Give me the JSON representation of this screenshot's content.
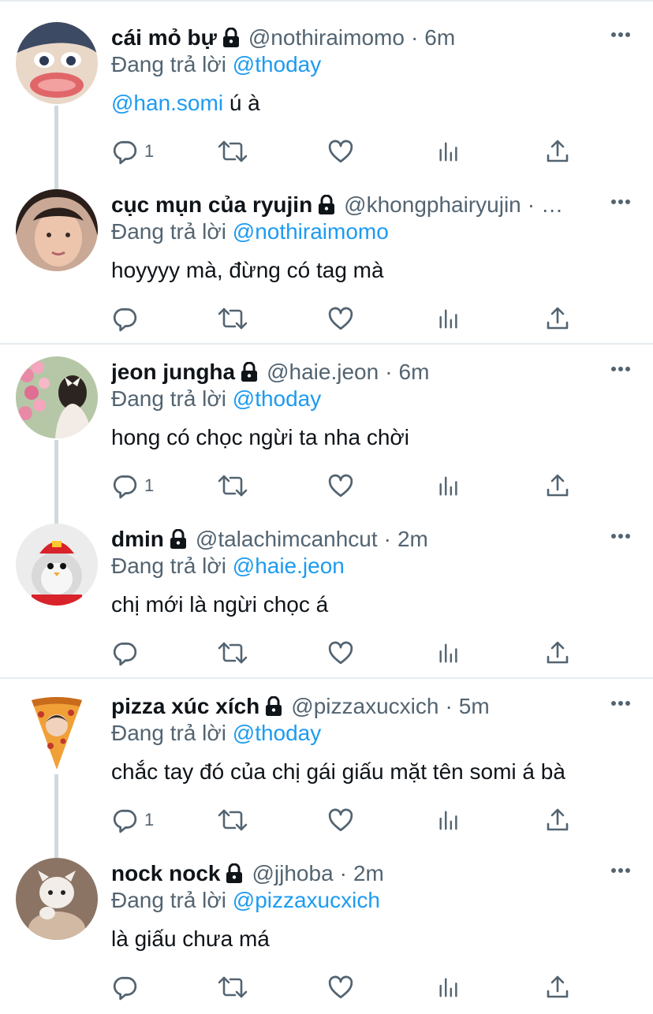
{
  "reply_prefix": "Đang trả lời",
  "tweets": [
    {
      "name": "cái mỏ bự",
      "handle": "@nothiraimomo",
      "time": "6m",
      "reply_to": "@thoday",
      "mention": "@han.somi",
      "text": " ú à",
      "reply_count": "1",
      "avatar": "anime-face-avatar"
    },
    {
      "name": "cục mụn của ryujin",
      "handle": "@khongphairyujin",
      "time": "…",
      "reply_to": "@nothiraimomo",
      "mention": "",
      "text": "hoyyyy mà, đừng có tag mà",
      "reply_count": "",
      "avatar": "girl-selfie-avatar"
    },
    {
      "name": "jeon jungha",
      "handle": "@haie.jeon",
      "time": "6m",
      "reply_to": "@thoday",
      "mention": "",
      "text": "hong có chọc ngừi ta nha chời",
      "reply_count": "1",
      "avatar": "flowers-girl-avatar"
    },
    {
      "name": "dmin",
      "handle": "@talachimcanhcut",
      "time": "2m",
      "reply_to": "@haie.jeon",
      "mention": "",
      "text": "chị mới là ngừi chọc á",
      "reply_count": "",
      "avatar": "penguin-mcdonalds-avatar"
    },
    {
      "name": "pizza xúc xích",
      "handle": "@pizzaxucxich",
      "time": "5m",
      "reply_to": "@thoday",
      "mention": "",
      "text": "chắc tay đó của chị gái giấu mặt tên somi á bà",
      "reply_count": "1",
      "avatar": "pizza-slice-avatar"
    },
    {
      "name": "nock nock",
      "handle": "@jjhoba",
      "time": "2m",
      "reply_to": "@pizzaxucxich",
      "mention": "",
      "text": "là giấu chưa má",
      "reply_count": "",
      "avatar": "kitten-avatar"
    }
  ],
  "colors": {
    "link": "#1d9bf0",
    "secondary": "#536471",
    "text": "#0f1419",
    "divider": "#e6ecf0",
    "thread_line": "#cfd9de"
  },
  "icons": {
    "reply": "speech-bubble-icon",
    "retweet": "retweet-icon",
    "like": "heart-icon",
    "views": "bar-chart-icon",
    "share": "share-icon",
    "more": "more-dots-icon",
    "protected": "lock-icon"
  }
}
